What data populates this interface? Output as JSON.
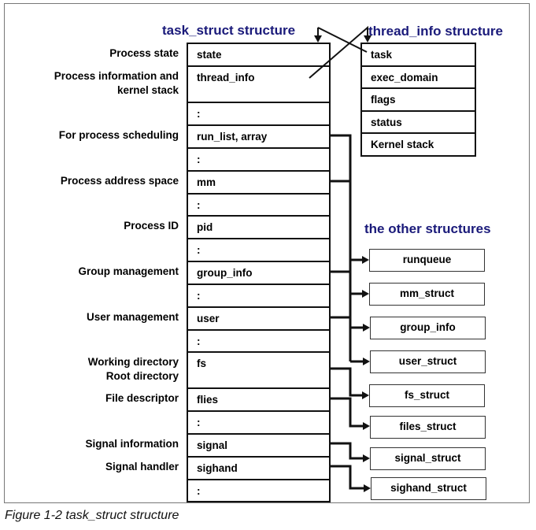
{
  "titles": {
    "task_struct": "task_struct structure",
    "thread_info": "thread_info structure",
    "other": "the other structures"
  },
  "task_struct": {
    "rows": [
      {
        "field": "state",
        "label": "Process state"
      },
      {
        "field": "thread_info",
        "label": "Process information and\nkernel stack"
      },
      {
        "field": ":",
        "label": ""
      },
      {
        "field": "run_list, array",
        "label": "For process scheduling"
      },
      {
        "field": ":",
        "label": ""
      },
      {
        "field": "mm",
        "label": "Process address space"
      },
      {
        "field": ":",
        "label": ""
      },
      {
        "field": "pid",
        "label": "Process ID"
      },
      {
        "field": ":",
        "label": ""
      },
      {
        "field": "group_info",
        "label": "Group management"
      },
      {
        "field": ":",
        "label": ""
      },
      {
        "field": "user",
        "label": "User management"
      },
      {
        "field": ":",
        "label": ""
      },
      {
        "field": "fs",
        "label": "Working directory\nRoot directory"
      },
      {
        "field": "flies",
        "label": "File descriptor"
      },
      {
        "field": ":",
        "label": ""
      },
      {
        "field": "signal",
        "label": "Signal information"
      },
      {
        "field": "sighand",
        "label": "Signal handler"
      },
      {
        "field": ":",
        "label": ""
      }
    ]
  },
  "thread_info": {
    "rows": [
      "task",
      "exec_domain",
      "flags",
      "status",
      "Kernel stack"
    ]
  },
  "other_structures": [
    "runqueue",
    "mm_struct",
    "group_info",
    "user_struct",
    "fs_struct",
    "files_struct",
    "signal_struct",
    "sighand_struct"
  ],
  "caption": "Figure 1-2   task_struct structure",
  "colors": {
    "title": "#1a1a7a",
    "frame": "#777777",
    "line": "#111111"
  }
}
